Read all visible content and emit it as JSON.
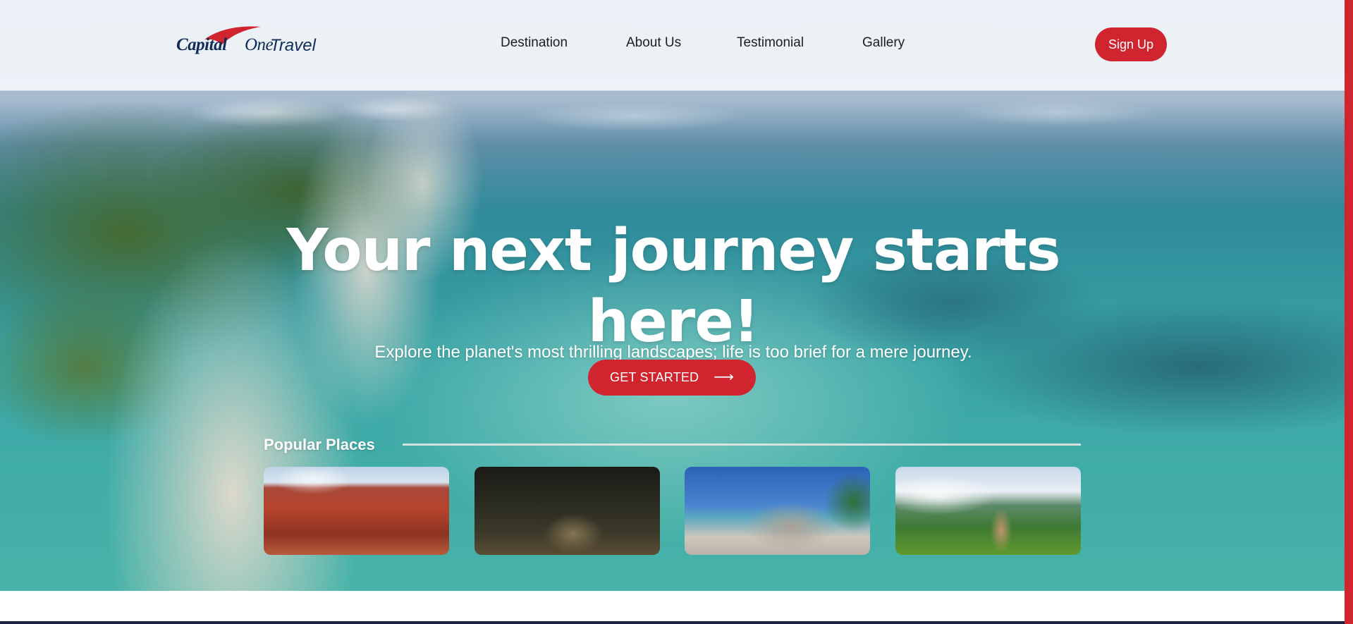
{
  "brand": {
    "logo_capital": "Capital",
    "logo_one": "One",
    "logo_travel": "Travel",
    "accent_color": "#d0252e",
    "logo_color": "#0f2c5a"
  },
  "nav": {
    "items": [
      "Destination",
      "About Us",
      "Testimonial",
      "Gallery"
    ],
    "signup_label": "Sign Up"
  },
  "hero": {
    "title": "Your next journey starts here!",
    "subtitle": "Explore the planet's most thrilling landscapes; life is too brief for a mere journey.",
    "cta_label": "GET STARTED",
    "cta_arrow": "⟶"
  },
  "popular": {
    "title": "Popular Places"
  }
}
